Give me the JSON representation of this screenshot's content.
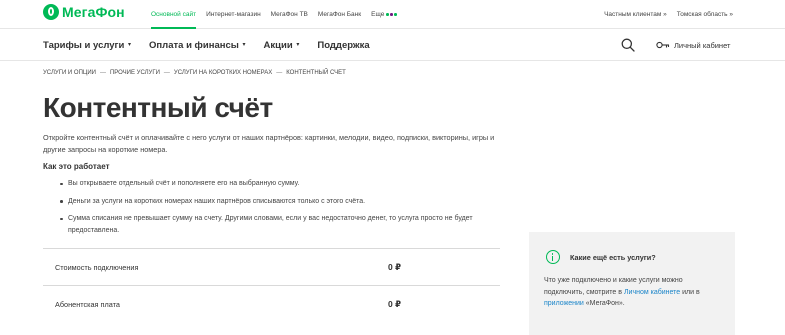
{
  "brand": {
    "name": "МегаФон",
    "color": "#00b956"
  },
  "topnav": {
    "items": [
      "Основной сайт",
      "Интернет-магазин",
      "МегаФон ТВ",
      "МегаФон Банк",
      "Еще"
    ],
    "active": "Основной сайт",
    "client_type": "Частным клиентам",
    "region": "Томская область"
  },
  "mainnav": {
    "items": [
      "Тарифы и услуги",
      "Оплата и финансы",
      "Акции",
      "Поддержка"
    ],
    "search_icon": "search-icon",
    "cabinet_label": "Личный кабинет"
  },
  "breadcrumb": [
    "Услуги и опции",
    "Прочие услуги",
    "Услуги на коротких номерах",
    "Контентный счет"
  ],
  "page": {
    "title": "Контентный счёт",
    "lead": "Откройте контентный счёт и оплачивайте с него услуги от наших партнёров: картинки, мелодии, видео, подписки, викторины, игры и другие запросы на короткие номера.",
    "how_title": "Как это работает",
    "bullets": [
      "Вы открываете отдельный счёт и пополняете его на выбранную сумму.",
      "Деньги за услуги на коротких номерах наших партнёров списываются только с этого счёта.",
      "Сумма списания не превышает сумму на счету. Другими словами, если у вас недостаточно денег, то услуга просто не будет предоставлена."
    ]
  },
  "prices": [
    {
      "label": "Стоимость подключения",
      "value": "0 ₽"
    },
    {
      "label": "Абонентская плата",
      "value": "0 ₽"
    }
  ],
  "card": {
    "title": "Какие ещё есть услуги?",
    "text_before": "Что уже подключено и какие услуги можно подключить, смотрите в ",
    "link1": "Личном кабинете",
    "text_middle": " или в ",
    "link2": "приложении",
    "text_after": " «МегаФон».",
    "icon": "info-icon"
  }
}
